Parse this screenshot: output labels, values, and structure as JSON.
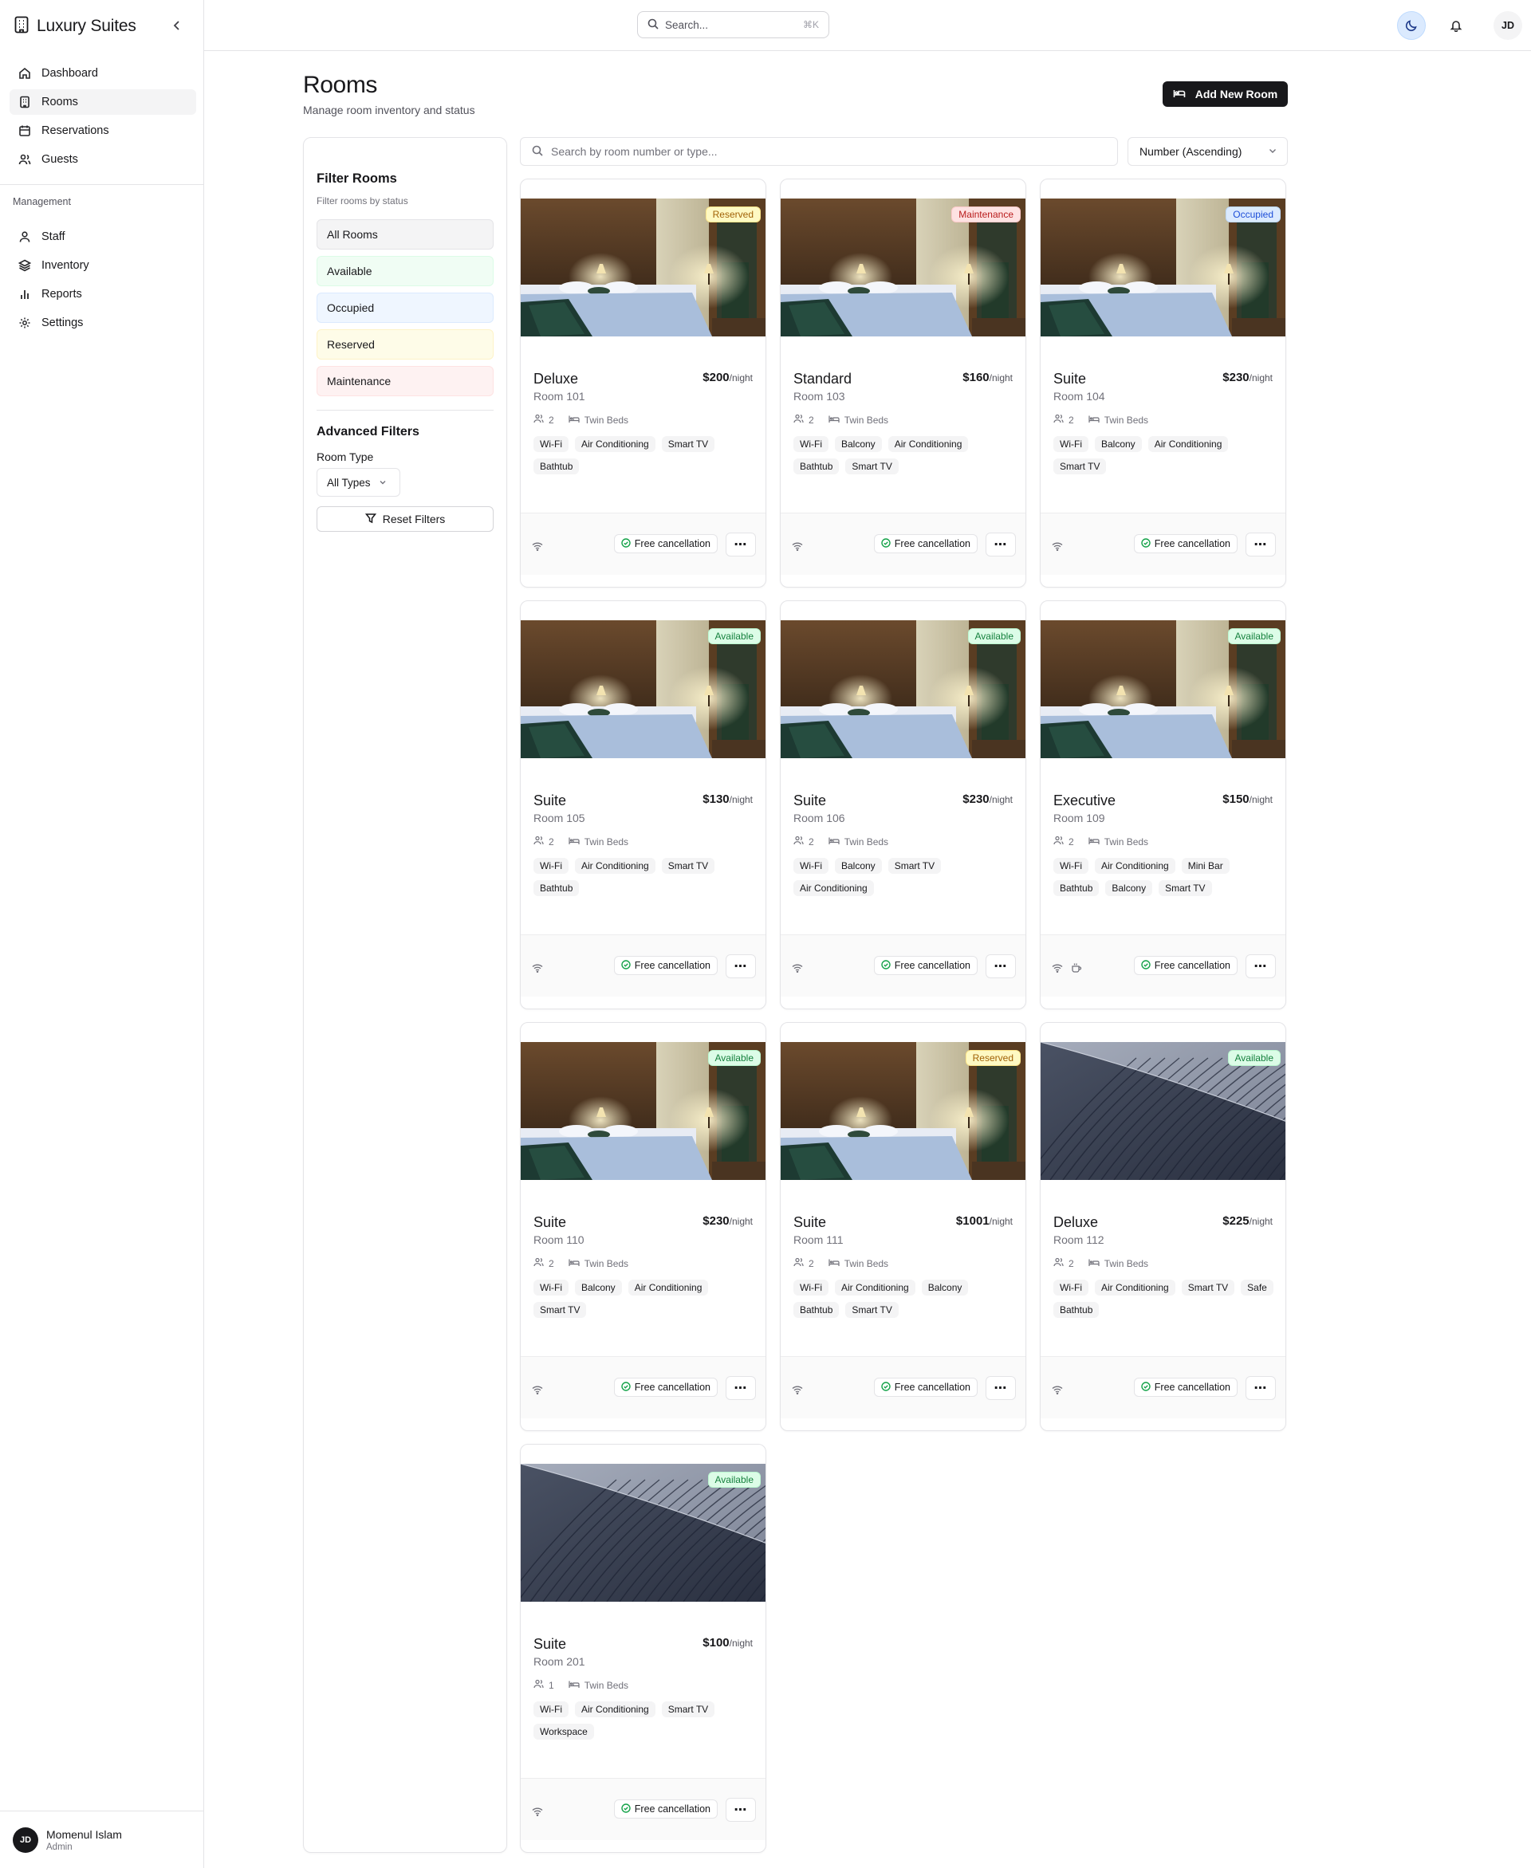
{
  "app": {
    "title": "Luxury Suites"
  },
  "sidebar": {
    "nav": [
      {
        "label": "Dashboard",
        "icon": "home-icon",
        "active": false
      },
      {
        "label": "Rooms",
        "icon": "building-icon",
        "active": true
      },
      {
        "label": "Reservations",
        "icon": "calendar-icon",
        "active": false
      },
      {
        "label": "Guests",
        "icon": "users-icon",
        "active": false
      }
    ],
    "section_label": "Management",
    "management": [
      {
        "label": "Staff",
        "icon": "user-icon"
      },
      {
        "label": "Inventory",
        "icon": "layers-icon"
      },
      {
        "label": "Reports",
        "icon": "bar-chart-icon"
      },
      {
        "label": "Settings",
        "icon": "gear-icon"
      }
    ],
    "user": {
      "initials": "JD",
      "name": "Momenul Islam",
      "role": "Admin"
    }
  },
  "topbar": {
    "search_placeholder": "Search...",
    "shortcut": "⌘K",
    "avatar_initials": "JD"
  },
  "page": {
    "title": "Rooms",
    "subtitle": "Manage room inventory and status",
    "add_button": "Add New Room"
  },
  "filters": {
    "title": "Filter Rooms",
    "subtitle": "Filter rooms by status",
    "options": [
      {
        "label": "All Rooms",
        "bg": "#f4f4f5",
        "border": "#e4e4e7"
      },
      {
        "label": "Available",
        "bg": "#f0fdf4",
        "border": "#dcfce7"
      },
      {
        "label": "Occupied",
        "bg": "#eff6ff",
        "border": "#dbeafe"
      },
      {
        "label": "Reserved",
        "bg": "#fefce8",
        "border": "#fef3c7"
      },
      {
        "label": "Maintenance",
        "bg": "#fef2f2",
        "border": "#fee2e2"
      }
    ],
    "advanced_title": "Advanced Filters",
    "room_type_label": "Room Type",
    "room_type_value": "All Types",
    "reset_label": "Reset Filters"
  },
  "room_search": {
    "placeholder": "Search by room number or type...",
    "sort_value": "Number (Ascending)"
  },
  "rooms": [
    {
      "type": "Deluxe",
      "number": "Room 101",
      "price": "$200",
      "per": "/night",
      "status": "Reserved",
      "status_class": "reserved",
      "guests": "2",
      "beds": "Twin Beds",
      "amenities": [
        "Wi-Fi",
        "Air Conditioning",
        "Smart TV",
        "Bathtub"
      ],
      "image": "bedroom",
      "footer_icons": [
        "wifi-icon"
      ],
      "cancellation": "Free cancellation"
    },
    {
      "type": "Standard",
      "number": "Room 103",
      "price": "$160",
      "per": "/night",
      "status": "Maintenance",
      "status_class": "maintenance",
      "guests": "2",
      "beds": "Twin Beds",
      "amenities": [
        "Wi-Fi",
        "Balcony",
        "Air Conditioning",
        "Bathtub",
        "Smart TV"
      ],
      "image": "bedroom",
      "footer_icons": [
        "wifi-icon"
      ],
      "cancellation": "Free cancellation"
    },
    {
      "type": "Suite",
      "number": "Room 104",
      "price": "$230",
      "per": "/night",
      "status": "Occupied",
      "status_class": "occupied",
      "guests": "2",
      "beds": "Twin Beds",
      "amenities": [
        "Wi-Fi",
        "Balcony",
        "Air Conditioning",
        "Smart TV"
      ],
      "image": "bedroom",
      "footer_icons": [
        "wifi-icon"
      ],
      "cancellation": "Free cancellation"
    },
    {
      "type": "Suite",
      "number": "Room 105",
      "price": "$130",
      "per": "/night",
      "status": "Available",
      "status_class": "available",
      "guests": "2",
      "beds": "Twin Beds",
      "amenities": [
        "Wi-Fi",
        "Air Conditioning",
        "Smart TV",
        "Bathtub"
      ],
      "image": "bedroom",
      "footer_icons": [
        "wifi-icon"
      ],
      "cancellation": "Free cancellation"
    },
    {
      "type": "Suite",
      "number": "Room 106",
      "price": "$230",
      "per": "/night",
      "status": "Available",
      "status_class": "available",
      "guests": "2",
      "beds": "Twin Beds",
      "amenities": [
        "Wi-Fi",
        "Balcony",
        "Smart TV",
        "Air Conditioning"
      ],
      "image": "bedroom",
      "footer_icons": [
        "wifi-icon"
      ],
      "cancellation": "Free cancellation"
    },
    {
      "type": "Executive",
      "number": "Room 109",
      "price": "$150",
      "per": "/night",
      "status": "Available",
      "status_class": "available",
      "guests": "2",
      "beds": "Twin Beds",
      "amenities": [
        "Wi-Fi",
        "Air Conditioning",
        "Mini Bar",
        "Bathtub",
        "Balcony",
        "Smart TV"
      ],
      "image": "bedroom",
      "footer_icons": [
        "wifi-icon",
        "coffee-icon"
      ],
      "cancellation": "Free cancellation"
    },
    {
      "type": "Suite",
      "number": "Room 110",
      "price": "$230",
      "per": "/night",
      "status": "Available",
      "status_class": "available",
      "guests": "2",
      "beds": "Twin Beds",
      "amenities": [
        "Wi-Fi",
        "Balcony",
        "Air Conditioning",
        "Smart TV"
      ],
      "image": "bedroom",
      "footer_icons": [
        "wifi-icon"
      ],
      "cancellation": "Free cancellation"
    },
    {
      "type": "Suite",
      "number": "Room 111",
      "price": "$1001",
      "per": "/night",
      "status": "Reserved",
      "status_class": "reserved",
      "guests": "2",
      "beds": "Twin Beds",
      "amenities": [
        "Wi-Fi",
        "Air Conditioning",
        "Balcony",
        "Bathtub",
        "Smart TV"
      ],
      "image": "bedroom",
      "footer_icons": [
        "wifi-icon"
      ],
      "cancellation": "Free cancellation"
    },
    {
      "type": "Deluxe",
      "number": "Room 112",
      "price": "$225",
      "per": "/night",
      "status": "Available",
      "status_class": "available",
      "guests": "2",
      "beds": "Twin Beds",
      "amenities": [
        "Wi-Fi",
        "Air Conditioning",
        "Smart TV",
        "Safe",
        "Bathtub"
      ],
      "image": "building",
      "footer_icons": [
        "wifi-icon"
      ],
      "cancellation": "Free cancellation"
    },
    {
      "type": "Suite",
      "number": "Room 201",
      "price": "$100",
      "per": "/night",
      "status": "Available",
      "status_class": "available",
      "guests": "1",
      "beds": "Twin Beds",
      "amenities": [
        "Wi-Fi",
        "Air Conditioning",
        "Smart TV",
        "Workspace"
      ],
      "image": "building",
      "footer_icons": [
        "wifi-icon"
      ],
      "cancellation": "Free cancellation"
    }
  ]
}
